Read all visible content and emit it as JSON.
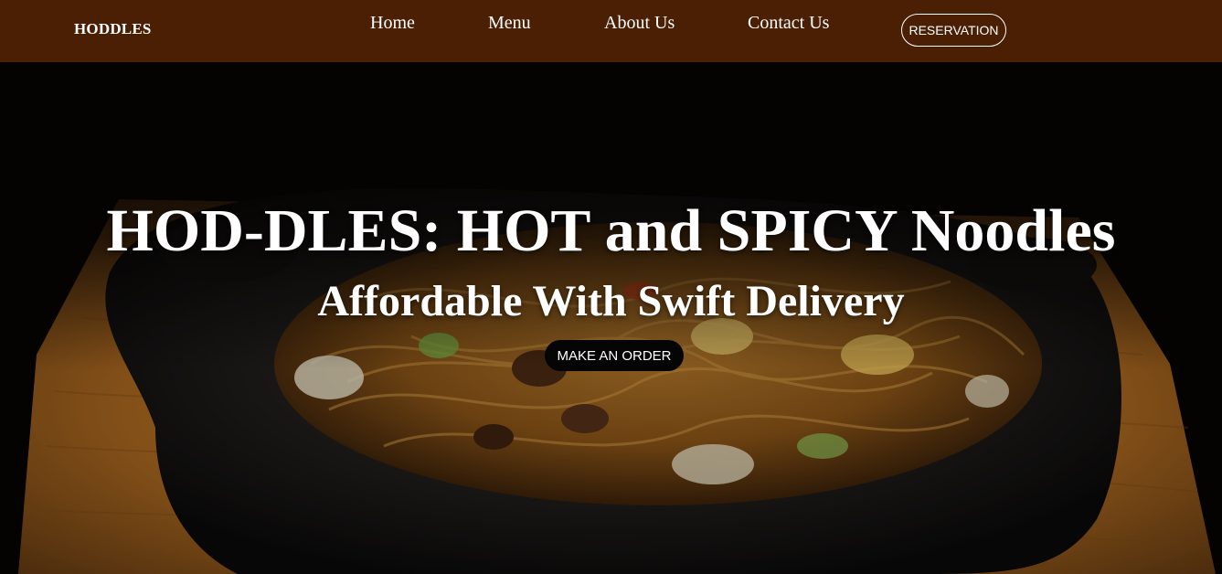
{
  "nav": {
    "brand": "HODDLES",
    "links": [
      {
        "label": "Home"
      },
      {
        "label": "Menu"
      },
      {
        "label": "About Us"
      },
      {
        "label": "Contact Us"
      }
    ],
    "reservation_label": "RESERVATION"
  },
  "hero": {
    "title": "HOD-DLES: HOT and SPICY Noodles",
    "subtitle": "Affordable With Swift Delivery",
    "cta_label": "MAKE AN ORDER",
    "image": "sizzling-noodles-on-cast-iron-platter"
  },
  "colors": {
    "navbar": "#4a1f04",
    "button_dark": "#050505",
    "text": "#ffffff"
  }
}
